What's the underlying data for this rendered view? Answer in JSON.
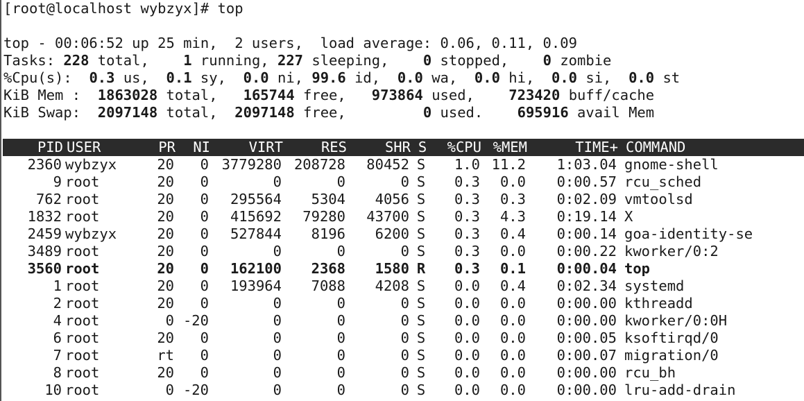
{
  "prompt": {
    "text": "[root@localhost wybzyx]# top"
  },
  "summary": {
    "line1": "top - 00:06:52 up 25 min,  2 users,  load average: 0.06, 0.11, 0.09",
    "tasks": {
      "label": "Tasks:",
      "total": "228",
      "total_lbl": "total,",
      "running": "1",
      "running_lbl": "running,",
      "sleeping": "227",
      "sleeping_lbl": "sleeping,",
      "stopped": "0",
      "stopped_lbl": "stopped,",
      "zombie": "0",
      "zombie_lbl": "zombie"
    },
    "cpu": {
      "label": "%Cpu(s):",
      "us": "0.3",
      "us_lbl": "us,",
      "sy": "0.1",
      "sy_lbl": "sy,",
      "ni": "0.0",
      "ni_lbl": "ni,",
      "id": "99.6",
      "id_lbl": "id,",
      "wa": "0.0",
      "wa_lbl": "wa,",
      "hi": "0.0",
      "hi_lbl": "hi,",
      "si": "0.0",
      "si_lbl": "si,",
      "st": "0.0",
      "st_lbl": "st"
    },
    "mem": {
      "label": "KiB Mem :",
      "total": "1863028",
      "total_lbl": "total,",
      "free": "165744",
      "free_lbl": "free,",
      "used": "973864",
      "used_lbl": "used,",
      "buff": "723420",
      "buff_lbl": "buff/cache"
    },
    "swap": {
      "label": "KiB Swap:",
      "total": "2097148",
      "total_lbl": "total,",
      "free": "2097148",
      "free_lbl": "free,",
      "used": "0",
      "used_lbl": "used.",
      "avail": "695916",
      "avail_lbl": "avail Mem"
    }
  },
  "table": {
    "columns": [
      "PID",
      "USER",
      "PR",
      "NI",
      "VIRT",
      "RES",
      "SHR",
      "S",
      "%CPU",
      "%MEM",
      "TIME+",
      "COMMAND"
    ],
    "rows": [
      [
        "2360",
        "wybzyx",
        "20",
        "0",
        "3779280",
        "208728",
        "80452",
        "S",
        "1.0",
        "11.2",
        "1:03.04",
        "gnome-shell"
      ],
      [
        "9",
        "root",
        "20",
        "0",
        "0",
        "0",
        "0",
        "S",
        "0.3",
        "0.0",
        "0:00.57",
        "rcu_sched"
      ],
      [
        "762",
        "root",
        "20",
        "0",
        "295564",
        "5304",
        "4056",
        "S",
        "0.3",
        "0.3",
        "0:02.09",
        "vmtoolsd"
      ],
      [
        "1832",
        "root",
        "20",
        "0",
        "415692",
        "79280",
        "43700",
        "S",
        "0.3",
        "4.3",
        "0:19.14",
        "X"
      ],
      [
        "2459",
        "wybzyx",
        "20",
        "0",
        "527844",
        "8196",
        "6200",
        "S",
        "0.3",
        "0.4",
        "0:00.14",
        "goa-identity-se"
      ],
      [
        "3489",
        "root",
        "20",
        "0",
        "0",
        "0",
        "0",
        "S",
        "0.3",
        "0.0",
        "0:00.22",
        "kworker/0:2"
      ],
      [
        "3560",
        "root",
        "20",
        "0",
        "162100",
        "2368",
        "1580",
        "R",
        "0.3",
        "0.1",
        "0:00.04",
        "top"
      ],
      [
        "1",
        "root",
        "20",
        "0",
        "193964",
        "7088",
        "4208",
        "S",
        "0.0",
        "0.4",
        "0:02.34",
        "systemd"
      ],
      [
        "2",
        "root",
        "20",
        "0",
        "0",
        "0",
        "0",
        "S",
        "0.0",
        "0.0",
        "0:00.00",
        "kthreadd"
      ],
      [
        "4",
        "root",
        "0",
        "-20",
        "0",
        "0",
        "0",
        "S",
        "0.0",
        "0.0",
        "0:00.00",
        "kworker/0:0H"
      ],
      [
        "6",
        "root",
        "20",
        "0",
        "0",
        "0",
        "0",
        "S",
        "0.0",
        "0.0",
        "0:00.05",
        "ksoftirqd/0"
      ],
      [
        "7",
        "root",
        "rt",
        "0",
        "0",
        "0",
        "0",
        "S",
        "0.0",
        "0.0",
        "0:00.07",
        "migration/0"
      ],
      [
        "8",
        "root",
        "20",
        "0",
        "0",
        "0",
        "0",
        "S",
        "0.0",
        "0.0",
        "0:00.00",
        "rcu_bh"
      ],
      [
        "10",
        "root",
        "0",
        "-20",
        "0",
        "0",
        "0",
        "S",
        "0.0",
        "0.0",
        "0:00.00",
        "lru-add-drain"
      ]
    ],
    "highlighted_pid": "3560"
  }
}
